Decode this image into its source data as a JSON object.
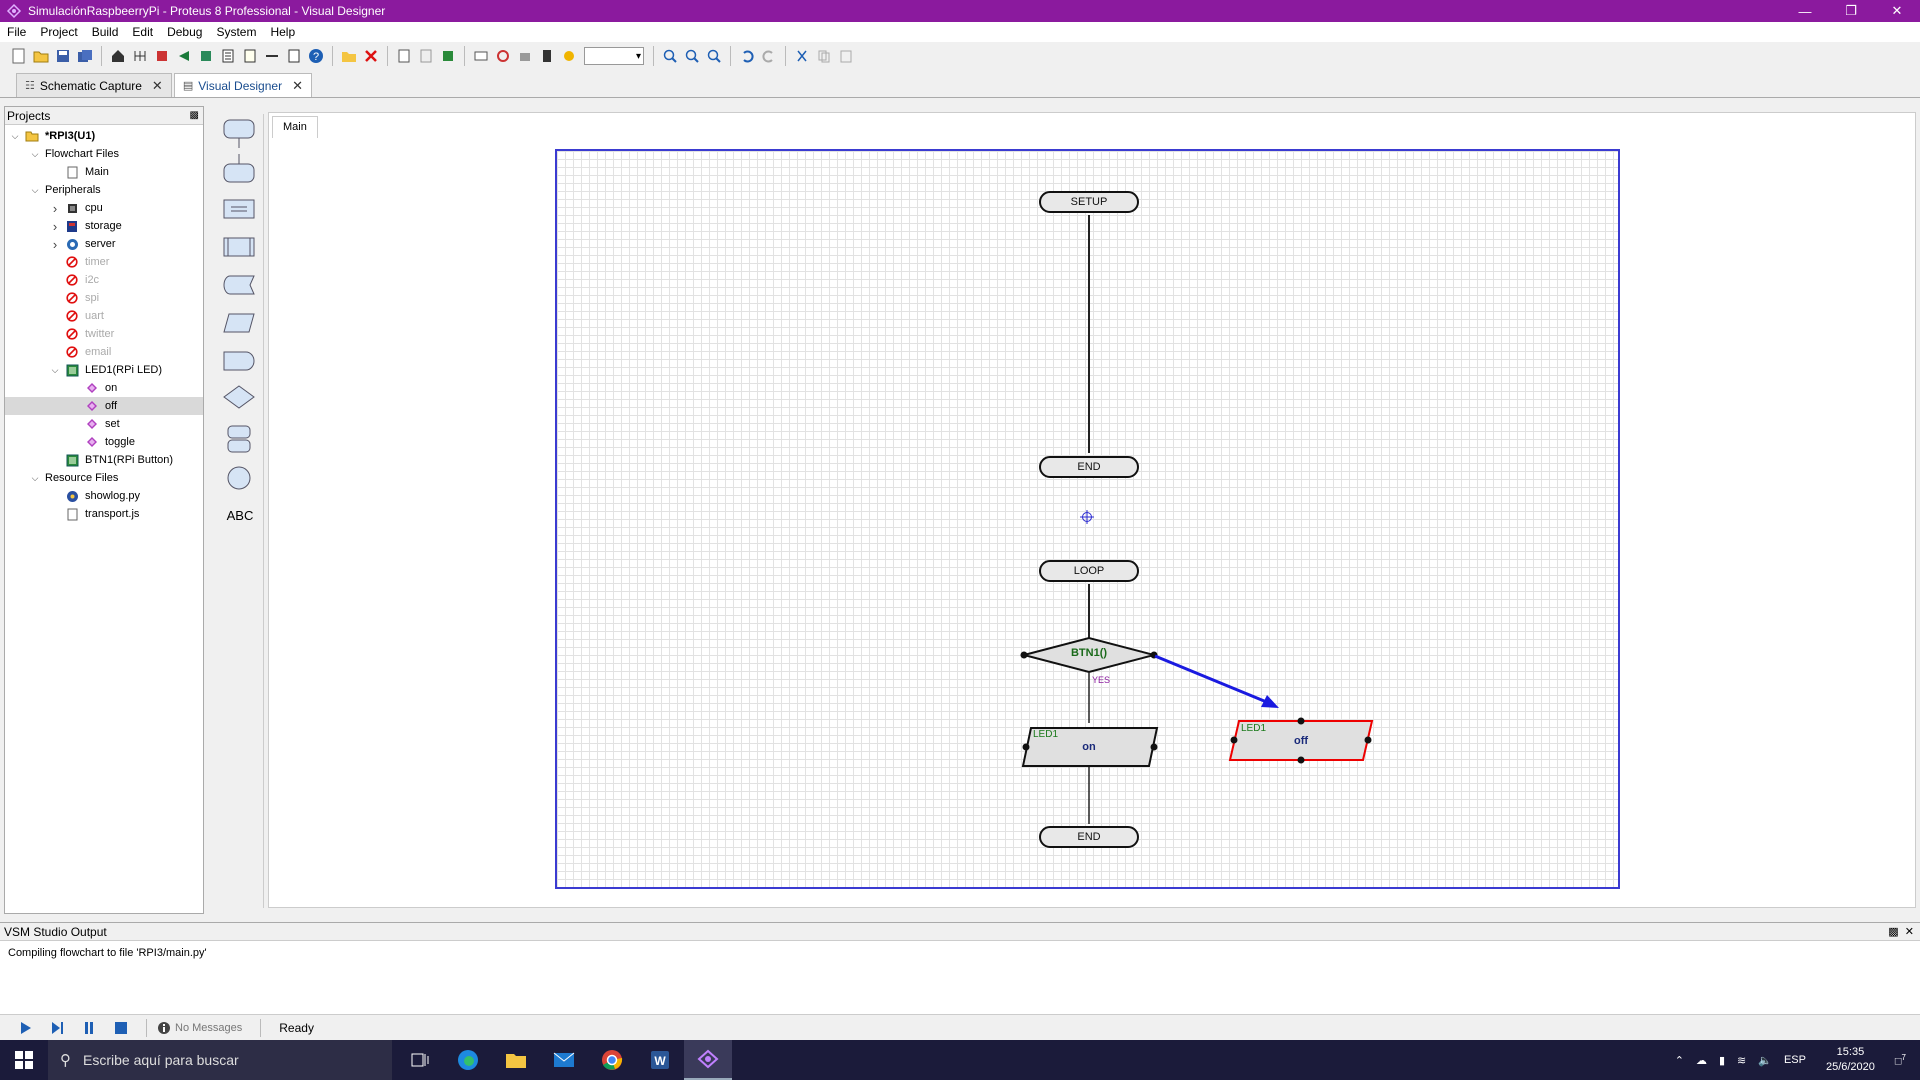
{
  "window": {
    "title": "SimulaciónRaspbeerryPi - Proteus 8 Professional - Visual Designer",
    "controls": [
      "minimize-icon",
      "restore-icon",
      "close-icon"
    ]
  },
  "menu": [
    "File",
    "Project",
    "Build",
    "Edit",
    "Debug",
    "System",
    "Help"
  ],
  "toolbar": {
    "zoom_value": ""
  },
  "doc_tabs": [
    {
      "label": "Schematic Capture",
      "active": false
    },
    {
      "label": "Visual Designer",
      "active": true
    }
  ],
  "projects": {
    "header": "Projects",
    "tree": [
      {
        "label": "*RPI3(U1)",
        "level": 0,
        "expander": "down",
        "icon": "folder-icon"
      },
      {
        "label": "Flowchart Files",
        "level": 1,
        "expander": "down",
        "icon": ""
      },
      {
        "label": "Main",
        "level": 2,
        "expander": "",
        "icon": "file-icon"
      },
      {
        "label": "Peripherals",
        "level": 1,
        "expander": "down",
        "icon": ""
      },
      {
        "label": "cpu",
        "level": 2,
        "expander": "right",
        "icon": "chip-icon"
      },
      {
        "label": "storage",
        "level": 2,
        "expander": "right",
        "icon": "storage-icon"
      },
      {
        "label": "server",
        "level": 2,
        "expander": "right",
        "icon": "server-icon"
      },
      {
        "label": "timer",
        "level": 2,
        "expander": "",
        "icon": "disabled-icon",
        "disabled": true
      },
      {
        "label": "i2c",
        "level": 2,
        "expander": "",
        "icon": "disabled-icon",
        "disabled": true
      },
      {
        "label": "spi",
        "level": 2,
        "expander": "",
        "icon": "disabled-icon",
        "disabled": true
      },
      {
        "label": "uart",
        "level": 2,
        "expander": "",
        "icon": "disabled-icon",
        "disabled": true
      },
      {
        "label": "twitter",
        "level": 2,
        "expander": "",
        "icon": "disabled-icon",
        "disabled": true
      },
      {
        "label": "email",
        "level": 2,
        "expander": "",
        "icon": "disabled-icon",
        "disabled": true
      },
      {
        "label": "LED1(RPi LED)",
        "level": 2,
        "expander": "down",
        "icon": "board-icon"
      },
      {
        "label": "on",
        "level": 3,
        "expander": "",
        "icon": "method-icon"
      },
      {
        "label": "off",
        "level": 3,
        "expander": "",
        "icon": "method-icon",
        "selected": true
      },
      {
        "label": "set",
        "level": 3,
        "expander": "",
        "icon": "method-icon"
      },
      {
        "label": "toggle",
        "level": 3,
        "expander": "",
        "icon": "method-icon"
      },
      {
        "label": "BTN1(RPi Button)",
        "level": 2,
        "expander": "",
        "icon": "board-icon"
      },
      {
        "label": "Resource Files",
        "level": 1,
        "expander": "down",
        "icon": ""
      },
      {
        "label": "showlog.py",
        "level": 2,
        "expander": "",
        "icon": "python-icon"
      },
      {
        "label": "transport.js",
        "level": 2,
        "expander": "",
        "icon": "file-icon"
      }
    ]
  },
  "palette": {
    "text_tool": "ABC"
  },
  "editor": {
    "tab": "Main",
    "setup_label": "SETUP",
    "setup_end_label": "END",
    "loop_label": "LOOP",
    "loop_end_label": "END",
    "decision_label": "BTN1()",
    "decision_yes": "YES",
    "io_on": {
      "device": "LED1",
      "method": "on"
    },
    "io_off": {
      "device": "LED1",
      "method": "off"
    }
  },
  "output": {
    "header": "VSM Studio Output",
    "line": "Compiling flowchart to file 'RPI3/main.py'"
  },
  "status": {
    "messages": "No Messages",
    "state": "Ready"
  },
  "taskbar": {
    "search_placeholder": "Escribe aquí para buscar",
    "lang": "ESP",
    "time": "15:35",
    "date": "25/6/2020",
    "notifications": "7"
  }
}
